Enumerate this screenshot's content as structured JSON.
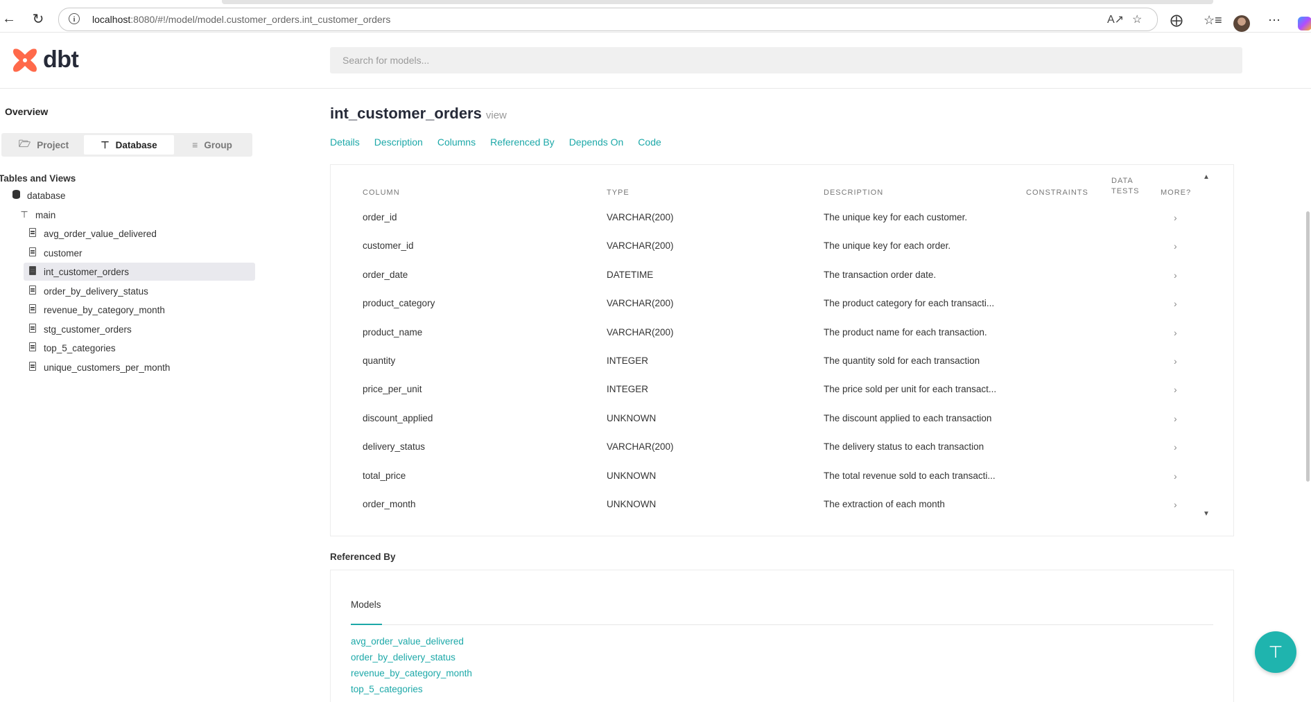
{
  "browser": {
    "url_host": "localhost",
    "url_rest": ":8080/#!/model/model.customer_orders.int_customer_orders"
  },
  "header": {
    "logo_text": "dbt",
    "search_placeholder": "Search for models..."
  },
  "sidebar": {
    "overview": "Overview",
    "segments": [
      "Project",
      "Database",
      "Group"
    ],
    "active_segment": "Database",
    "tables_heading": "Tables and Views",
    "database": "database",
    "schema": "main",
    "models": [
      "avg_order_value_delivered",
      "customer",
      "int_customer_orders",
      "order_by_delivery_status",
      "revenue_by_category_month",
      "stg_customer_orders",
      "top_5_categories",
      "unique_customers_per_month"
    ],
    "selected_model": "int_customer_orders"
  },
  "model": {
    "name": "int_customer_orders",
    "kind": "view",
    "tabs": [
      "Details",
      "Description",
      "Columns",
      "Referenced By",
      "Depends On",
      "Code"
    ]
  },
  "columns_table": {
    "headers": {
      "column": "COLUMN",
      "type": "TYPE",
      "description": "DESCRIPTION",
      "constraints": "CONSTRAINTS",
      "data_tests_1": "DATA",
      "data_tests_2": "TESTS",
      "more": "MORE?"
    },
    "rows": [
      {
        "column": "order_id",
        "type": "VARCHAR(200)",
        "description": "The unique key for each customer."
      },
      {
        "column": "customer_id",
        "type": "VARCHAR(200)",
        "description": "The unique key for each order."
      },
      {
        "column": "order_date",
        "type": "DATETIME",
        "description": "The transaction order date."
      },
      {
        "column": "product_category",
        "type": "VARCHAR(200)",
        "description": "The product category for each transacti..."
      },
      {
        "column": "product_name",
        "type": "VARCHAR(200)",
        "description": "The product name for each transaction."
      },
      {
        "column": "quantity",
        "type": "INTEGER",
        "description": "The quantity sold for each transaction"
      },
      {
        "column": "price_per_unit",
        "type": "INTEGER",
        "description": "The price sold per unit for each transact..."
      },
      {
        "column": "discount_applied",
        "type": "UNKNOWN",
        "description": "The discount applied to each transaction"
      },
      {
        "column": "delivery_status",
        "type": "VARCHAR(200)",
        "description": "The delivery status to each transaction"
      },
      {
        "column": "total_price",
        "type": "UNKNOWN",
        "description": "The total revenue sold to each transacti..."
      },
      {
        "column": "order_month",
        "type": "UNKNOWN",
        "description": "The extraction of each month"
      }
    ]
  },
  "referenced_by": {
    "heading": "Referenced By",
    "tab": "Models",
    "links": [
      "avg_order_value_delivered",
      "order_by_delivery_status",
      "revenue_by_category_month",
      "top_5_categories"
    ]
  },
  "colors": {
    "accent": "#1ca8a8",
    "dbt_orange": "#ff694a",
    "fab": "#1fb4ae"
  }
}
